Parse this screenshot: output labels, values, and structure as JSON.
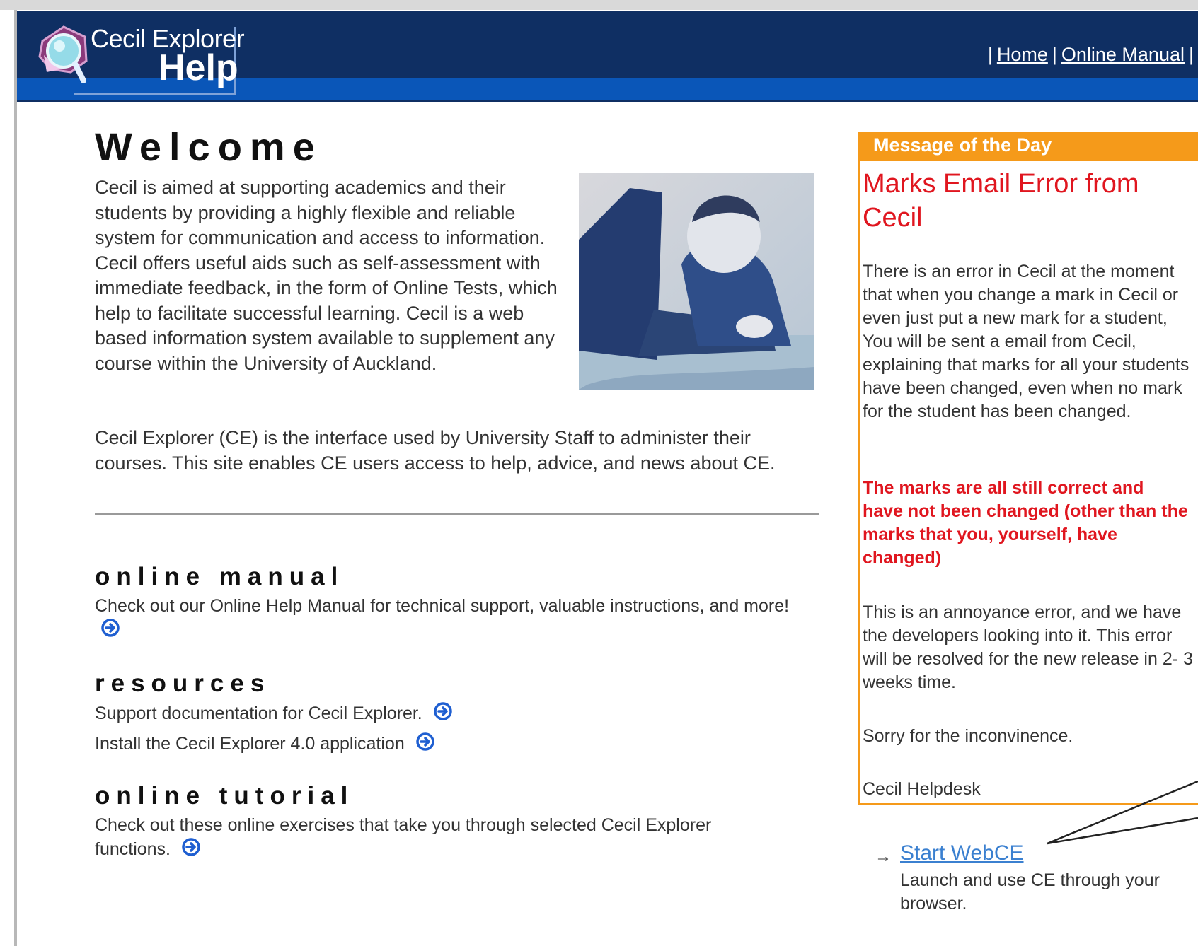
{
  "header": {
    "logo_title": "Cecil Explorer",
    "logo_subtitle": "Help",
    "nav_separator": "|",
    "nav": [
      {
        "label": "Home"
      },
      {
        "label": "Online Manual"
      }
    ]
  },
  "main": {
    "welcome_title": "Welcome",
    "intro_paragraph": "Cecil is aimed at supporting academics and their students by providing a highly flexible and reliable system for communication and access to information. Cecil offers useful aids such as self-assessment with immediate feedback, in the form of Online Tests, which help to facilitate successful learning. Cecil is a web based information system available to supplement any course within the University of Auckland.",
    "ce_paragraph": "Cecil Explorer (CE) is the interface used by University Staff to administer their courses. This site enables CE users access to help, advice, and news about CE.",
    "sections": [
      {
        "title": "online manual",
        "lines": [
          "Check out our Online Help Manual for technical support, valuable instructions, and more!"
        ]
      },
      {
        "title": "resources",
        "lines": [
          "Support documentation for Cecil Explorer.",
          "Install the Cecil Explorer 4.0 application"
        ]
      },
      {
        "title": "online tutorial",
        "lines": [
          "Check out these online exercises that take you through selected Cecil Explorer functions."
        ]
      }
    ]
  },
  "sidebar": {
    "motd_header": "Message of the Day",
    "motd_title": "Marks Email Error from Cecil",
    "motd_para1": "There is an error in Cecil at the moment that when you change a mark in Cecil or even just put a new mark for a student, You will be sent a email from Cecil, explaining that marks for all your students have been changed, even when no mark for the student has been changed.",
    "motd_red": "The marks are all still correct and have not been changed (other than the marks that you, yourself, have changed)",
    "motd_para2": "This is an annoyance error, and we have the developers looking into it. This error will be resolved for the new release in 2- 3 weeks time.",
    "motd_sorry": "Sorry for the inconvinence.",
    "motd_sign": "Cecil Helpdesk",
    "webce_link": "Start WebCE",
    "webce_desc": "Launch and use CE through your browser."
  },
  "colors": {
    "header_bg": "#0f2f63",
    "header_stripe": "#0a56b8",
    "motd_orange": "#f59a1a",
    "alert_red": "#e0161f",
    "link_blue": "#3b80d0",
    "go_icon_blue": "#1f5fd1"
  },
  "icons": [
    "magnifier-logo-icon",
    "go-arrow-icon",
    "bullet-arrow-icon",
    "callout-pointer-icon"
  ]
}
